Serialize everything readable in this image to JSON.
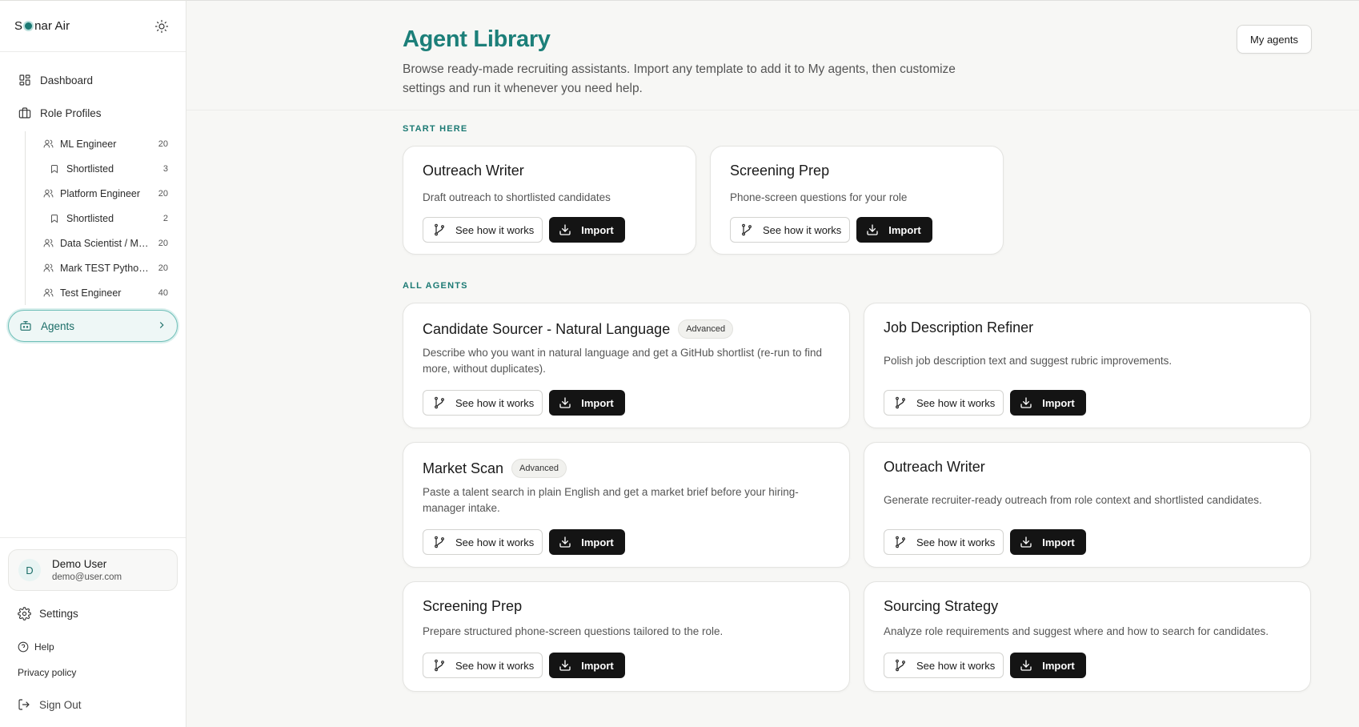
{
  "brand": {
    "prefix": "S",
    "suffix": "nar Air"
  },
  "nav": {
    "dashboard": "Dashboard",
    "role_profiles": "Role Profiles",
    "roles": [
      {
        "label": "ML Engineer",
        "count": "20",
        "sub": false
      },
      {
        "label": "Shortlisted",
        "count": "3",
        "sub": true
      },
      {
        "label": "Platform Engineer",
        "count": "20",
        "sub": false
      },
      {
        "label": "Shortlisted",
        "count": "2",
        "sub": true
      },
      {
        "label": "Data Scientist / ML ...",
        "count": "20",
        "sub": false
      },
      {
        "label": "Mark TEST Python ...",
        "count": "20",
        "sub": false
      },
      {
        "label": "Test Engineer",
        "count": "40",
        "sub": false
      }
    ],
    "agents": "Agents"
  },
  "user": {
    "initial": "D",
    "name": "Demo User",
    "email": "demo@user.com"
  },
  "bottom": {
    "settings": "Settings",
    "help": "Help",
    "privacy": "Privacy policy",
    "sign_out": "Sign Out"
  },
  "header": {
    "title": "Agent Library",
    "description": "Browse ready-made recruiting assistants. Import any template to add it to My agents, then customize settings and run it whenever you need help.",
    "my_agents": "My agents"
  },
  "sections": {
    "start_here": "START HERE",
    "all_agents": "ALL AGENTS"
  },
  "buttons": {
    "see_how": "See how it works",
    "import": "Import"
  },
  "start_here": [
    {
      "title": "Outreach Writer",
      "desc": "Draft outreach to shortlisted candidates"
    },
    {
      "title": "Screening Prep",
      "desc": "Phone-screen questions for your role"
    }
  ],
  "all_agents": [
    {
      "title": "Candidate Sourcer - Natural Language",
      "badge": "Advanced",
      "desc": "Describe who you want in natural language and get a GitHub shortlist (re-run to find more, without duplicates)."
    },
    {
      "title": "Job Description Refiner",
      "badge": "",
      "desc": "Polish job description text and suggest rubric improvements."
    },
    {
      "title": "Market Scan",
      "badge": "Advanced",
      "desc": "Paste a talent search in plain English and get a market brief before your hiring-manager intake."
    },
    {
      "title": "Outreach Writer",
      "badge": "",
      "desc": "Generate recruiter-ready outreach from role context and shortlisted candidates."
    },
    {
      "title": "Screening Prep",
      "badge": "",
      "desc": "Prepare structured phone-screen questions tailored to the role."
    },
    {
      "title": "Sourcing Strategy",
      "badge": "",
      "desc": "Analyze role requirements and suggest where and how to search for candidates."
    }
  ]
}
